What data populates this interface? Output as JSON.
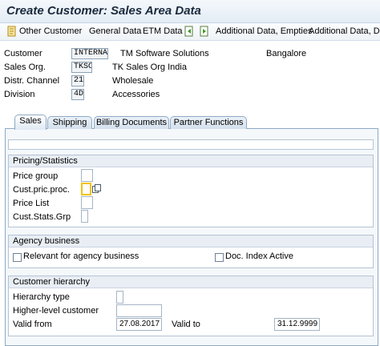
{
  "window": {
    "title": "Create Customer: Sales Area Data"
  },
  "toolbar": {
    "other_customer": "Other Customer",
    "general_data": "General Data",
    "etm_data": "ETM Data",
    "additional_data_empties": "Additional Data, Empties",
    "additional_data_dsd": "Additional Data, DSD"
  },
  "header": {
    "customer": {
      "label": "Customer",
      "value": "INTERNAL",
      "text": "TM Software Solutions",
      "city": "Bangalore"
    },
    "sales_org": {
      "label": "Sales Org.",
      "value": "TKSO",
      "text": "TK Sales Org India"
    },
    "distr_channel": {
      "label": "Distr. Channel",
      "value": "21",
      "text": "Wholesale"
    },
    "division": {
      "label": "Division",
      "value": "4D",
      "text": "Accessories"
    }
  },
  "tabs": [
    {
      "label": "Sales",
      "active": true
    },
    {
      "label": "Shipping",
      "active": false
    },
    {
      "label": "Billing Documents",
      "active": false
    },
    {
      "label": "Partner Functions",
      "active": false
    }
  ],
  "pricing": {
    "title": "Pricing/Statistics",
    "price_group": {
      "label": "Price group",
      "value": ""
    },
    "cust_pric_proc": {
      "label": "Cust.pric.proc.",
      "value": ""
    },
    "price_list": {
      "label": "Price List",
      "value": ""
    },
    "cust_stats_grp": {
      "label": "Cust.Stats.Grp",
      "value": ""
    }
  },
  "agency": {
    "title": "Agency business",
    "relevant": {
      "label": "Relevant for agency business",
      "checked": false
    },
    "doc_index": {
      "label": "Doc. Index Active",
      "checked": false
    }
  },
  "hierarchy": {
    "title": "Customer hierarchy",
    "hierarchy_type": {
      "label": "Hierarchy type",
      "value": ""
    },
    "higher_level": {
      "label": "Higher-level customer",
      "value": ""
    },
    "valid_from": {
      "label": "Valid from",
      "value": "27.08.2017"
    },
    "valid_to": {
      "label": "Valid to",
      "value": "31.12.9999"
    }
  },
  "colors": {
    "accent": "#8ea9c4",
    "group_header": "#e9eef4",
    "focus": "#f2c200"
  }
}
